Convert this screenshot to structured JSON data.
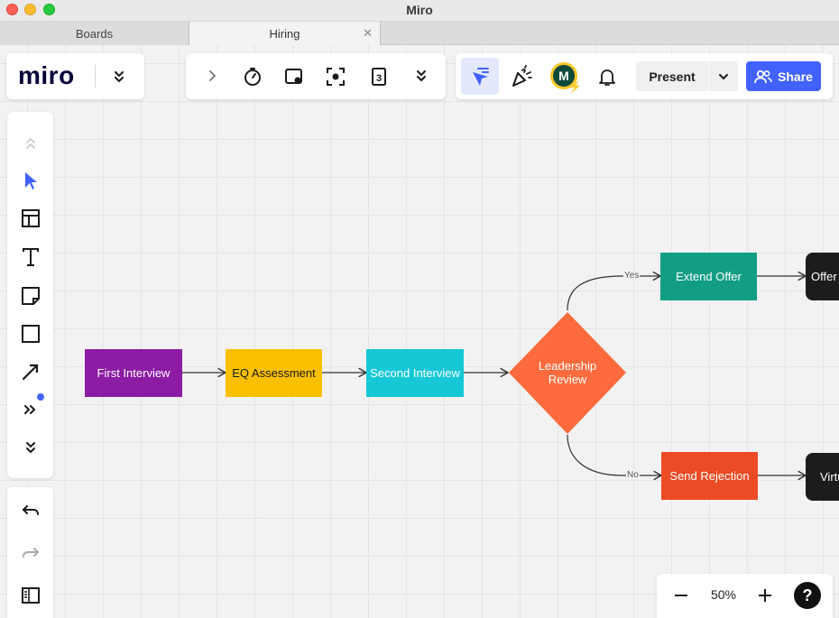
{
  "window": {
    "title": "Miro"
  },
  "tabs": [
    {
      "label": "Boards"
    },
    {
      "label": "Hiring"
    }
  ],
  "logo": {
    "text": "miro"
  },
  "topbar": {
    "present_label": "Present",
    "share_label": "Share",
    "avatar_initial": "M",
    "timer_badge": "3"
  },
  "zoom": {
    "level": "50%",
    "help": "?"
  },
  "flowchart": {
    "nodes": {
      "first_interview": "First Interview",
      "eq_assessment": "EQ Assessment",
      "second_interview": "Second Interview",
      "leadership_review": "Leadership Review",
      "extend_offer": "Extend Offer",
      "send_rejection": "Send Rejection",
      "offer": "Offer",
      "virtual": "Virtu"
    },
    "edges": {
      "yes_label": "Yes",
      "no_label": "No"
    }
  },
  "colors": {
    "accent": "#4262ff",
    "first_interview": "#8b1ca3",
    "eq_assessment": "#fbc002",
    "second_interview": "#16c8d6",
    "leadership_review": "#ff6b3d",
    "extend_offer": "#129e85",
    "send_rejection": "#eb4b25",
    "terminal": "#1c1c1c"
  },
  "icons": {
    "toolbar": [
      "chevron-right-icon",
      "timer-icon",
      "frames-icon",
      "focus-icon",
      "countdown-icon",
      "more-icon"
    ],
    "right": [
      "select-cursor-icon",
      "celebrate-icon",
      "bell-icon",
      "chevron-down-icon",
      "people-icon"
    ],
    "left": [
      "collapse-up-icon",
      "cursor-icon",
      "templates-icon",
      "text-icon",
      "sticky-note-icon",
      "shape-icon",
      "pen-icon",
      "more-tools-icon",
      "expand-icon",
      "undo-icon",
      "redo-icon",
      "board-panel-icon"
    ]
  }
}
